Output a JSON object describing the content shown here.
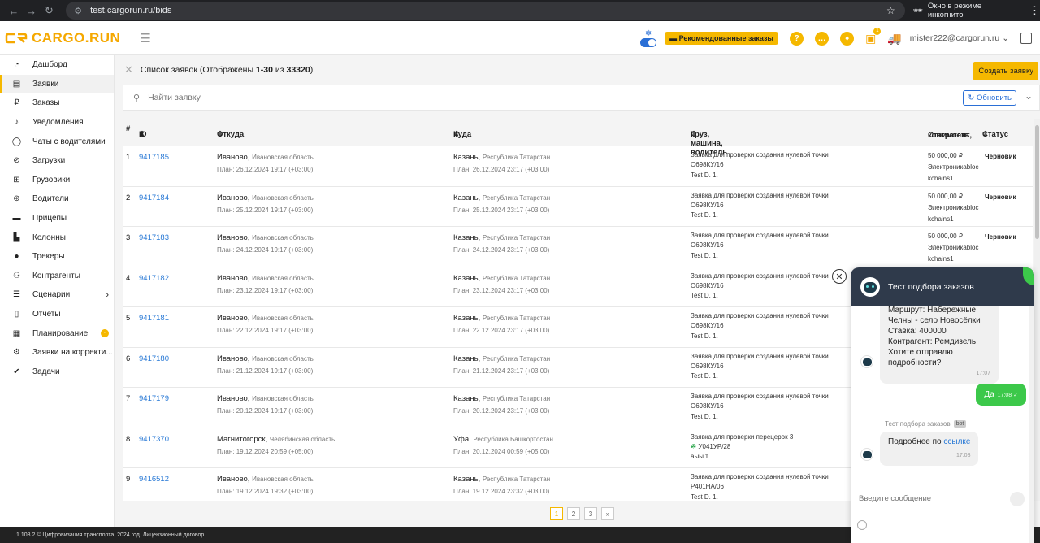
{
  "browser": {
    "url": "test.cargorun.ru/bids",
    "incognito_label": "Окно в режиме инкогнито"
  },
  "header": {
    "logo_text": "CARGO.RUN",
    "recommended_label": "Рекомендованные заказы",
    "user_email": "mister222@cargorun.ru",
    "cart_badge": "1"
  },
  "sidebar": {
    "items": [
      {
        "label": "Дашборд",
        "icon": "dashboard-icon"
      },
      {
        "label": "Заявки",
        "icon": "bids-icon"
      },
      {
        "label": "Заказы",
        "icon": "ruble-icon"
      },
      {
        "label": "Уведомления",
        "icon": "bell-icon"
      },
      {
        "label": "Чаты с водителями",
        "icon": "chat-icon"
      },
      {
        "label": "Загрузки",
        "icon": "compass-icon"
      },
      {
        "label": "Грузовики",
        "icon": "truck-icon"
      },
      {
        "label": "Водители",
        "icon": "steering-wheel-icon"
      },
      {
        "label": "Прицепы",
        "icon": "trailer-icon"
      },
      {
        "label": "Колонны",
        "icon": "convoy-icon"
      },
      {
        "label": "Трекеры",
        "icon": "pin-icon"
      },
      {
        "label": "Контрагенты",
        "icon": "people-icon"
      },
      {
        "label": "Сценарии",
        "icon": "list-icon"
      },
      {
        "label": "Отчеты",
        "icon": "report-icon"
      },
      {
        "label": "Планирование",
        "icon": "planning-icon"
      },
      {
        "label": "Заявки на корректи...",
        "icon": "correction-icon"
      },
      {
        "label": "Задачи",
        "icon": "check-icon"
      }
    ]
  },
  "main": {
    "title_prefix": "Список заявок",
    "title_shown": "(Отображены",
    "title_range": "1-30",
    "title_of": "из",
    "title_total": "33320",
    "title_close": ")",
    "create_label": "Создать заявку",
    "search_placeholder": "Найти заявку",
    "refresh_label": "Обновить"
  },
  "table": {
    "headers": {
      "num": "#",
      "id": "ID",
      "from": "Откуда",
      "to": "Куда",
      "cargo": "Груз, машина, водитель",
      "price": "Стоимость,",
      "price2": "контрагент",
      "status": "Статус"
    },
    "rows": [
      {
        "num": "1",
        "id": "9417185",
        "from_city": "Иваново,",
        "from_region": "Ивановская область",
        "from_plan": "План: 26.12.2024 19:17 (+03:00)",
        "to_city": "Казань,",
        "to_region": "Республика Татарстан",
        "to_plan": "План: 26.12.2024 23:17 (+03:00)",
        "cargo": "Заявка для проверки создания нулевой точки",
        "vehicle": "О698КУ/16",
        "driver": "Test D. 1.",
        "price": "50 000,00 ₽",
        "contractor": "Электроникаblockchains1",
        "status": "Черновик"
      },
      {
        "num": "2",
        "id": "9417184",
        "from_city": "Иваново,",
        "from_region": "Ивановская область",
        "from_plan": "План: 25.12.2024 19:17 (+03:00)",
        "to_city": "Казань,",
        "to_region": "Республика Татарстан",
        "to_plan": "План: 25.12.2024 23:17 (+03:00)",
        "cargo": "Заявка для проверки создания нулевой точки",
        "vehicle": "О698КУ/16",
        "driver": "Test D. 1.",
        "price": "50 000,00 ₽",
        "contractor": "Электроникаblockchains1",
        "status": "Черновик"
      },
      {
        "num": "3",
        "id": "9417183",
        "from_city": "Иваново,",
        "from_region": "Ивановская область",
        "from_plan": "План: 24.12.2024 19:17 (+03:00)",
        "to_city": "Казань,",
        "to_region": "Республика Татарстан",
        "to_plan": "План: 24.12.2024 23:17 (+03:00)",
        "cargo": "Заявка для проверки создания нулевой точки",
        "vehicle": "О698КУ/16",
        "driver": "Test D. 1.",
        "price": "50 000,00 ₽",
        "contractor": "Электроникаblockchains1",
        "status": "Черновик"
      },
      {
        "num": "4",
        "id": "9417182",
        "from_city": "Иваново,",
        "from_region": "Ивановская область",
        "from_plan": "План: 23.12.2024 19:17 (+03:00)",
        "to_city": "Казань,",
        "to_region": "Республика Татарстан",
        "to_plan": "План: 23.12.2024 23:17 (+03:00)",
        "cargo": "Заявка для проверки создания нулевой точки",
        "vehicle": "О698КУ/16",
        "driver": "Test D. 1.",
        "price": "",
        "contractor": "",
        "status": ""
      },
      {
        "num": "5",
        "id": "9417181",
        "from_city": "Иваново,",
        "from_region": "Ивановская область",
        "from_plan": "План: 22.12.2024 19:17 (+03:00)",
        "to_city": "Казань,",
        "to_region": "Республика Татарстан",
        "to_plan": "План: 22.12.2024 23:17 (+03:00)",
        "cargo": "Заявка для проверки создания нулевой точки",
        "vehicle": "О698КУ/16",
        "driver": "Test D. 1.",
        "price": "",
        "contractor": "",
        "status": ""
      },
      {
        "num": "6",
        "id": "9417180",
        "from_city": "Иваново,",
        "from_region": "Ивановская область",
        "from_plan": "План: 21.12.2024 19:17 (+03:00)",
        "to_city": "Казань,",
        "to_region": "Республика Татарстан",
        "to_plan": "План: 21.12.2024 23:17 (+03:00)",
        "cargo": "Заявка для проверки создания нулевой точки",
        "vehicle": "О698КУ/16",
        "driver": "Test D. 1.",
        "price": "",
        "contractor": "",
        "status": ""
      },
      {
        "num": "7",
        "id": "9417179",
        "from_city": "Иваново,",
        "from_region": "Ивановская область",
        "from_plan": "План: 20.12.2024 19:17 (+03:00)",
        "to_city": "Казань,",
        "to_region": "Республика Татарстан",
        "to_plan": "План: 20.12.2024 23:17 (+03:00)",
        "cargo": "Заявка для проверки создания нулевой точки",
        "vehicle": "О698КУ/16",
        "driver": "Test D. 1.",
        "price": "",
        "contractor": "",
        "status": ""
      },
      {
        "num": "8",
        "id": "9417370",
        "from_city": "Магнитогорск,",
        "from_region": "Челябинская область",
        "from_plan": "План: 19.12.2024 20:59 (+05:00)",
        "to_city": "Уфа,",
        "to_region": "Республика Башкортостан",
        "to_plan": "План: 20.12.2024 00:59 (+05:00)",
        "cargo": "Заявка для проверки перецерок 3",
        "vehicle": "У041УР/28",
        "driver": "аыы т.",
        "price": "",
        "contractor": "",
        "status": ""
      },
      {
        "num": "9",
        "id": "9416512",
        "from_city": "Иваново,",
        "from_region": "Ивановская область",
        "from_plan": "План: 19.12.2024 19:32 (+03:00)",
        "to_city": "Казань,",
        "to_region": "Республика Татарстан",
        "to_plan": "План: 19.12.2024 23:32 (+03:00)",
        "cargo": "Заявка для проверки создания нулевой точки",
        "vehicle": "Р401НА/06",
        "driver": "Test D. 1.",
        "price": "",
        "contractor": "",
        "status": ""
      }
    ]
  },
  "pager": {
    "pages": [
      "1",
      "2",
      "3"
    ],
    "next": "»"
  },
  "footer": {
    "text": "1.108.2 © Цифровизация транспорта, 2024 год.  Лицензионный договор"
  },
  "chat": {
    "title": "Тест подбора заказов",
    "msg1": "Маршрут: Набережные Челны - село Новосёлки Ставка: 400000 Контрагент: Ремдизель Хотите отправлю подробности?",
    "msg1_time": "17:07",
    "reply": "Да",
    "reply_time": "17:08 ✓",
    "sender": "Тест подбора заказов",
    "bot_label": "bot",
    "msg2_prefix": "Подробнее по ",
    "msg2_link": "ссылке",
    "msg2_time": "17:08",
    "input_placeholder": "Введите сообщение"
  }
}
